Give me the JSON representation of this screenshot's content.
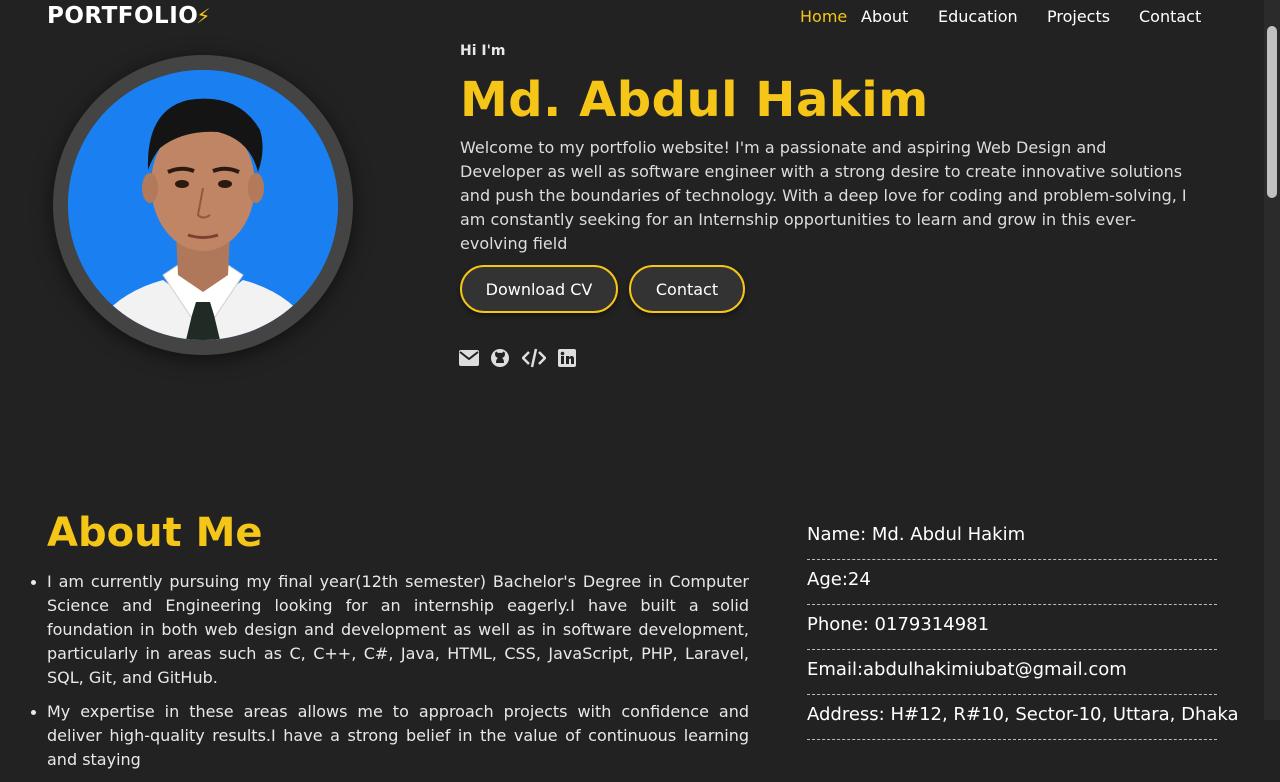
{
  "nav": {
    "logo": "PORTFOLIO",
    "logo_icon": "lightning-bolt-icon",
    "links": [
      {
        "label": "Home",
        "active": true
      },
      {
        "label": "About",
        "active": false
      },
      {
        "label": "Education",
        "active": false
      },
      {
        "label": "Projects",
        "active": false
      },
      {
        "label": "Contact",
        "active": false
      }
    ]
  },
  "hero": {
    "greeting": "Hi I'm",
    "name": "Md. Abdul Hakim",
    "description": "Welcome to my portfolio website! I'm a passionate and aspiring Web Design and Developer as well as software engineer with a strong desire to create innovative solutions and push the boundaries of technology. With a deep love for coding and problem-solving, I am constantly seeking for an Internship opportunities to learn and grow in this ever-evolving field",
    "buttons": {
      "download_cv": "Download CV",
      "contact": "Contact"
    },
    "socials": [
      "email-icon",
      "github-icon",
      "code-icon",
      "linkedin-icon"
    ]
  },
  "about": {
    "title": "About Me",
    "points": [
      "I am currently pursuing my final year(12th semester) Bachelor's Degree in Computer Science and Engineering looking for an internship eagerly.I have built a solid foundation in both web design and development as well as in software development, particularly in areas such as C, C++, C#, Java, HTML, CSS, JavaScript, PHP, Laravel, SQL, Git, and GitHub.",
      "My expertise in these areas allows me to approach projects with confidence and deliver high-quality results.I have a strong belief in the value of continuous learning and staying"
    ],
    "info": [
      "Name: Md. Abdul Hakim",
      "Age:24",
      "Phone: 0179314981",
      "Email:abdulhakimiubat@gmail.com",
      "Address: H#12, R#10, Sector-10, Uttara, Dhaka"
    ]
  },
  "colors": {
    "accent": "#f5c518",
    "background": "#222222"
  }
}
